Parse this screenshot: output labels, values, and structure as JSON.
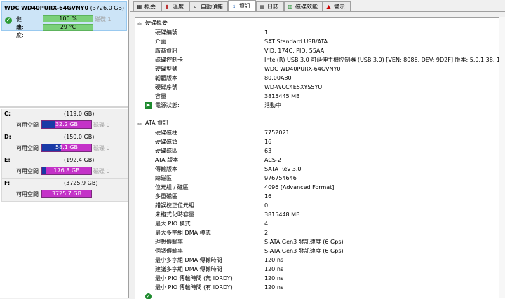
{
  "disk": {
    "name": "WDC WD40PURX-64GVNY0",
    "capacity": "(3726.0 GB)",
    "metrics": [
      {
        "label": "健康:",
        "value": "100 %",
        "side": "磁碟 1"
      },
      {
        "label": "溫度:",
        "value": "29 °C",
        "side": ""
      }
    ]
  },
  "volumes": [
    {
      "letter": "C:",
      "size": "(119.0 GB)",
      "free_label": "可用空間",
      "free": "32.2 GB",
      "used_fraction": 0.27,
      "side": "磁碟 0"
    },
    {
      "letter": "D:",
      "size": "(150.0 GB)",
      "free_label": "可用空間",
      "free": "58.1 GB",
      "used_fraction": 0.39,
      "side": "磁碟 0"
    },
    {
      "letter": "E:",
      "size": "(192.4 GB)",
      "free_label": "可用空間",
      "free": "176.8 GB",
      "used_fraction": 0.08,
      "side": "磁碟 0"
    },
    {
      "letter": "F:",
      "size": "(3725.9 GB)",
      "free_label": "可用空間",
      "free": "3725.7 GB",
      "used_fraction": 0.0,
      "side": ""
    }
  ],
  "tabs": [
    {
      "label": "概要",
      "icon": "grid-icon"
    },
    {
      "label": "溫度",
      "icon": "thermometer-icon"
    },
    {
      "label": "自動偵錯",
      "icon": "magnifier-icon"
    },
    {
      "label": "資訊",
      "icon": "info-icon"
    },
    {
      "label": "日誌",
      "icon": "document-icon"
    },
    {
      "label": "磁碟效能",
      "icon": "chart-icon"
    },
    {
      "label": "警示",
      "icon": "alert-icon"
    }
  ],
  "active_tab": "資訊",
  "sections": [
    {
      "title": "硬碟概要",
      "rows": [
        {
          "k": "硬碟編號",
          "v": "1"
        },
        {
          "k": "介面",
          "v": "SAT Standard USB/ATA"
        },
        {
          "k": "廠商資訊",
          "v": "VID: 174C, PID: 55AA"
        },
        {
          "k": "磁碟控制卡",
          "v": "Intel(R) USB 3.0 可延伸主機控制器 (USB 3.0) [VEN: 8086, DEV: 9D2F] 版本: 5.0.1.38, 11-16-2016"
        },
        {
          "k": "硬碟型號",
          "v": "WDC WD40PURX-64GVNY0"
        },
        {
          "k": "韌體版本",
          "v": "80.00A80"
        },
        {
          "k": "硬碟序號",
          "v": "WD-WCC4E5XYS5YU"
        },
        {
          "k": "容量",
          "v": "3815445 MB"
        },
        {
          "k": "電源狀態:",
          "v": "活動中",
          "icon": "power-icon"
        }
      ]
    },
    {
      "title": "ATA 資訊",
      "rows": [
        {
          "k": "硬碟磁柱",
          "v": "7752021"
        },
        {
          "k": "硬碟磁頭",
          "v": "16"
        },
        {
          "k": "硬碟磁區",
          "v": "63"
        },
        {
          "k": "ATA 版本",
          "v": "ACS-2"
        },
        {
          "k": "傳輸版本",
          "v": "SATA Rev 3.0"
        },
        {
          "k": "總磁區",
          "v": "976754646"
        },
        {
          "k": "位元組 / 磁區",
          "v": "4096 [Advanced Format]"
        },
        {
          "k": "多重磁區",
          "v": "16"
        },
        {
          "k": "錯誤校正位元組",
          "v": "0"
        },
        {
          "k": "未格式化時容量",
          "v": "3815448 MB"
        },
        {
          "k": "最大 PIO 模式",
          "v": "4"
        },
        {
          "k": "最大多字組 DMA 模式",
          "v": "2"
        },
        {
          "k": "理想傳輸率",
          "v": "S-ATA Gen3 發訊速度 (6 Gps)"
        },
        {
          "k": "個調傳輸率",
          "v": "S-ATA Gen3 發訊速度 (6 Gps)"
        },
        {
          "k": "最小多字組 DMA 傳輸時間",
          "v": "120 ns"
        },
        {
          "k": "建議多字組 DMA 傳輸時間",
          "v": "120 ns"
        },
        {
          "k": "最小 PIO 傳輸時間 (無 IORDY)",
          "v": "120 ns"
        },
        {
          "k": "最小 PIO 傳輸時間 (有 IORDY)",
          "v": "120 ns"
        }
      ]
    }
  ],
  "colors": {
    "selection": "#cce4f7",
    "health_bar": "#7bd07a",
    "volume_used": "#1a3aa7",
    "volume_free": "#c432c8",
    "ok_green": "#2c9b35"
  }
}
